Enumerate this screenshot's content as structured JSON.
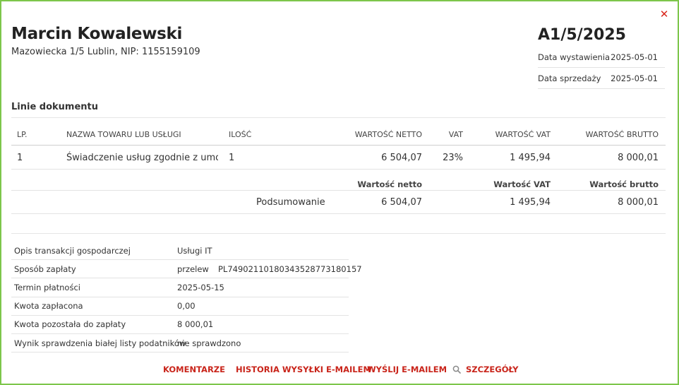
{
  "seller": {
    "name": "Marcin Kowalewski",
    "address": "Mazowiecka 1/5 Lublin, NIP: 1155159109"
  },
  "document": {
    "number": "A1/5/2025",
    "meta": [
      {
        "label": "Data wystawienia",
        "value": "2025-05-01"
      },
      {
        "label": "Data sprzedaży",
        "value": "2025-05-01"
      }
    ]
  },
  "lines": {
    "title": "Linie dokumentu",
    "headers": {
      "lp": "LP.",
      "name": "NAZWA TOWARU LUB USŁUGI",
      "qty": "ILOŚĆ",
      "net": "WARTOŚĆ NETTO",
      "vat": "VAT",
      "vat_value": "WARTOŚĆ VAT",
      "gross": "WARTOŚĆ BRUTTO"
    },
    "rows": [
      {
        "lp": "1",
        "name": "Świadczenie usług zgodnie z umo...",
        "qty": "1",
        "net": "6 504,07",
        "vat": "23%",
        "vat_value": "1 495,94",
        "gross": "8 000,01"
      }
    ]
  },
  "summary": {
    "headers": {
      "net": "Wartość netto",
      "vat_value": "Wartość VAT",
      "gross": "Wartość brutto"
    },
    "label": "Podsumowanie",
    "net": "6 504,07",
    "vat_value": "1 495,94",
    "gross": "8 000,01"
  },
  "info": [
    {
      "label": "Opis transakcji gospodarczej",
      "value": "Usługi IT",
      "extra": ""
    },
    {
      "label": "Sposób zapłaty",
      "value": "przelew",
      "extra": "PL74902110180343528773180157"
    },
    {
      "label": "Termin płatności",
      "value": "2025-05-15",
      "extra": ""
    },
    {
      "label": "Kwota zapłacona",
      "value": "0,00",
      "extra": ""
    },
    {
      "label": "Kwota pozostała do zapłaty",
      "value": "8 000,01",
      "extra": ""
    },
    {
      "label": "Wynik sprawdzenia białej listy podatników",
      "value": "nie sprawdzono",
      "extra": ""
    }
  ],
  "actions": {
    "comments": "KOMENTARZE",
    "email_history": "HISTORIA WYSYŁKI E-MAILEM",
    "send_email": "WYŚLIJ E-MAILEM",
    "details": "SZCZEGÓŁY"
  },
  "icons": {
    "close": "close-icon",
    "search": "search-icon"
  },
  "colors": {
    "frame": "#7dc64b",
    "accent": "#c9251b",
    "close": "#d8261b"
  }
}
